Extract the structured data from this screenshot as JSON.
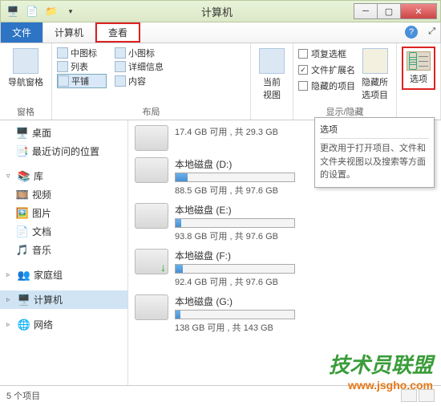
{
  "window": {
    "title": "计算机"
  },
  "tabs": {
    "file": "文件",
    "computer": "计算机",
    "view": "查看"
  },
  "ribbon": {
    "panes": {
      "label": "窗格",
      "nav": "导航窗格"
    },
    "layout": {
      "label": "布局",
      "items": {
        "medium": "中图标",
        "small": "小图标",
        "list": "列表",
        "details": "详细信息",
        "tiles": "平铺",
        "content": "内容"
      }
    },
    "current": {
      "label": "当前\n视图"
    },
    "showhide": {
      "label": "显示/隐藏",
      "checkboxes": "项复选框",
      "extensions": "文件扩展名",
      "hidden": "隐藏的项目",
      "hidebtn": "隐藏所\n选项目"
    },
    "options": {
      "label": "选项"
    }
  },
  "tooltip": {
    "title": "选项",
    "body": "更改用于打开项目、文件和文件夹视图以及搜索等方面的设置。"
  },
  "sidebar": {
    "desktop": "桌面",
    "recent": "最近访问的位置",
    "libraries": "库",
    "videos": "视频",
    "pictures": "图片",
    "documents": "文档",
    "music": "音乐",
    "homegroup": "家庭组",
    "computer": "计算机",
    "network": "网络"
  },
  "drives": [
    {
      "name": "",
      "free": "17.4 GB 可用 , 共 29.3 GB",
      "pct": 42,
      "partial": true
    },
    {
      "name": "本地磁盘 (D:)",
      "free": "88.5 GB 可用 , 共 97.6 GB",
      "pct": 10
    },
    {
      "name": "本地磁盘 (E:)",
      "free": "93.8 GB 可用 , 共 97.6 GB",
      "pct": 5
    },
    {
      "name": "本地磁盘 (F:)",
      "free": "92.4 GB 可用 , 共 97.6 GB",
      "pct": 6,
      "dl": true
    },
    {
      "name": "本地磁盘 (G:)",
      "free": "138 GB 可用 , 共 143 GB",
      "pct": 4
    }
  ],
  "status": {
    "count": "5 个项目"
  },
  "watermark": {
    "line1": "技术员联盟",
    "line2": "www.jsgho.com"
  }
}
